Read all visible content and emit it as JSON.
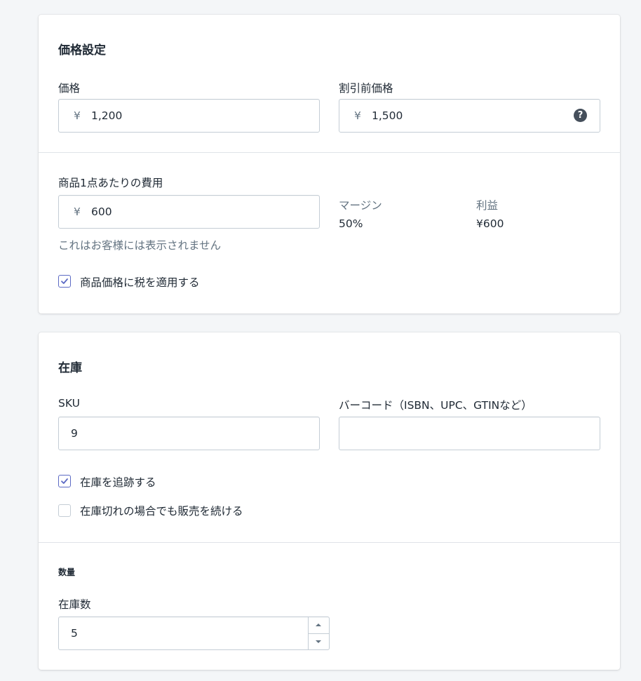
{
  "pricing": {
    "title": "価格設定",
    "price_label": "価格",
    "currency_symbol": "¥",
    "price_value": "1,200",
    "compare_label": "割引前価格",
    "compare_value": "1,500",
    "help_icon": "question-circle-icon",
    "cost_label": "商品1点あたりの費用",
    "cost_value": "600",
    "cost_help": "これはお客様には表示されません",
    "margin_label": "マージン",
    "margin_value": "50%",
    "profit_label": "利益",
    "profit_value": "¥600",
    "tax_checkbox_label": "商品価格に税を適用する",
    "tax_checked": true
  },
  "inventory": {
    "title": "在庫",
    "sku_label": "SKU",
    "sku_value": "9",
    "barcode_label": "バーコード（ISBN、UPC、GTINなど）",
    "barcode_value": "",
    "track_label": "在庫を追跡する",
    "track_checked": true,
    "continue_label": "在庫切れの場合でも販売を続ける",
    "continue_checked": false,
    "quantity_title": "数量",
    "available_label": "在庫数",
    "available_value": "5"
  },
  "colors": {
    "accent": "#5c6ac4",
    "border": "#c4cdd5",
    "background": "#f4f6f8",
    "subdued_text": "#637381"
  }
}
